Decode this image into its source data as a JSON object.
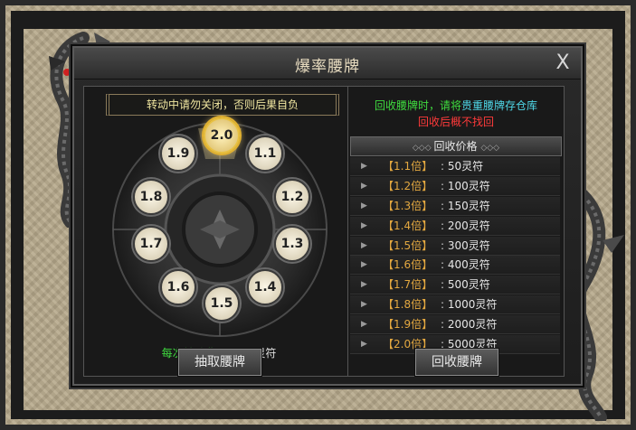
{
  "window": {
    "title": "爆率腰牌",
    "close_label": "X"
  },
  "left": {
    "warning": "转动中请勿关闭，否则后果自负",
    "wheel": {
      "values": [
        "2.0",
        "1.1",
        "1.2",
        "1.3",
        "1.4",
        "1.5",
        "1.6",
        "1.7",
        "1.8",
        "1.9"
      ],
      "selected": "2.0"
    },
    "cost_label": "每次转动费用:",
    "cost_value": "200灵符",
    "draw_button": "抽取腰牌"
  },
  "right": {
    "notice_green": "回收腰牌时，请将",
    "notice_cyan": "贵重腰牌存仓库",
    "notice_red": "回收后概不找回",
    "price_header": "回收价格",
    "prices": [
      {
        "mult": "【1.1倍】",
        "amount": "50灵符"
      },
      {
        "mult": "【1.2倍】",
        "amount": "100灵符"
      },
      {
        "mult": "【1.3倍】",
        "amount": "150灵符"
      },
      {
        "mult": "【1.4倍】",
        "amount": "200灵符"
      },
      {
        "mult": "【1.5倍】",
        "amount": "300灵符"
      },
      {
        "mult": "【1.6倍】",
        "amount": "400灵符"
      },
      {
        "mult": "【1.7倍】",
        "amount": "500灵符"
      },
      {
        "mult": "【1.8倍】",
        "amount": "1000灵符"
      },
      {
        "mult": "【1.9倍】",
        "amount": "2000灵符"
      },
      {
        "mult": "【2.0倍】",
        "amount": "5000灵符"
      }
    ],
    "recycle_button": "回收腰牌"
  },
  "colors": {
    "gold": "#e3a840",
    "green": "#3fdc3f",
    "cyan": "#4fd8e8",
    "red": "#ff3a3a"
  }
}
